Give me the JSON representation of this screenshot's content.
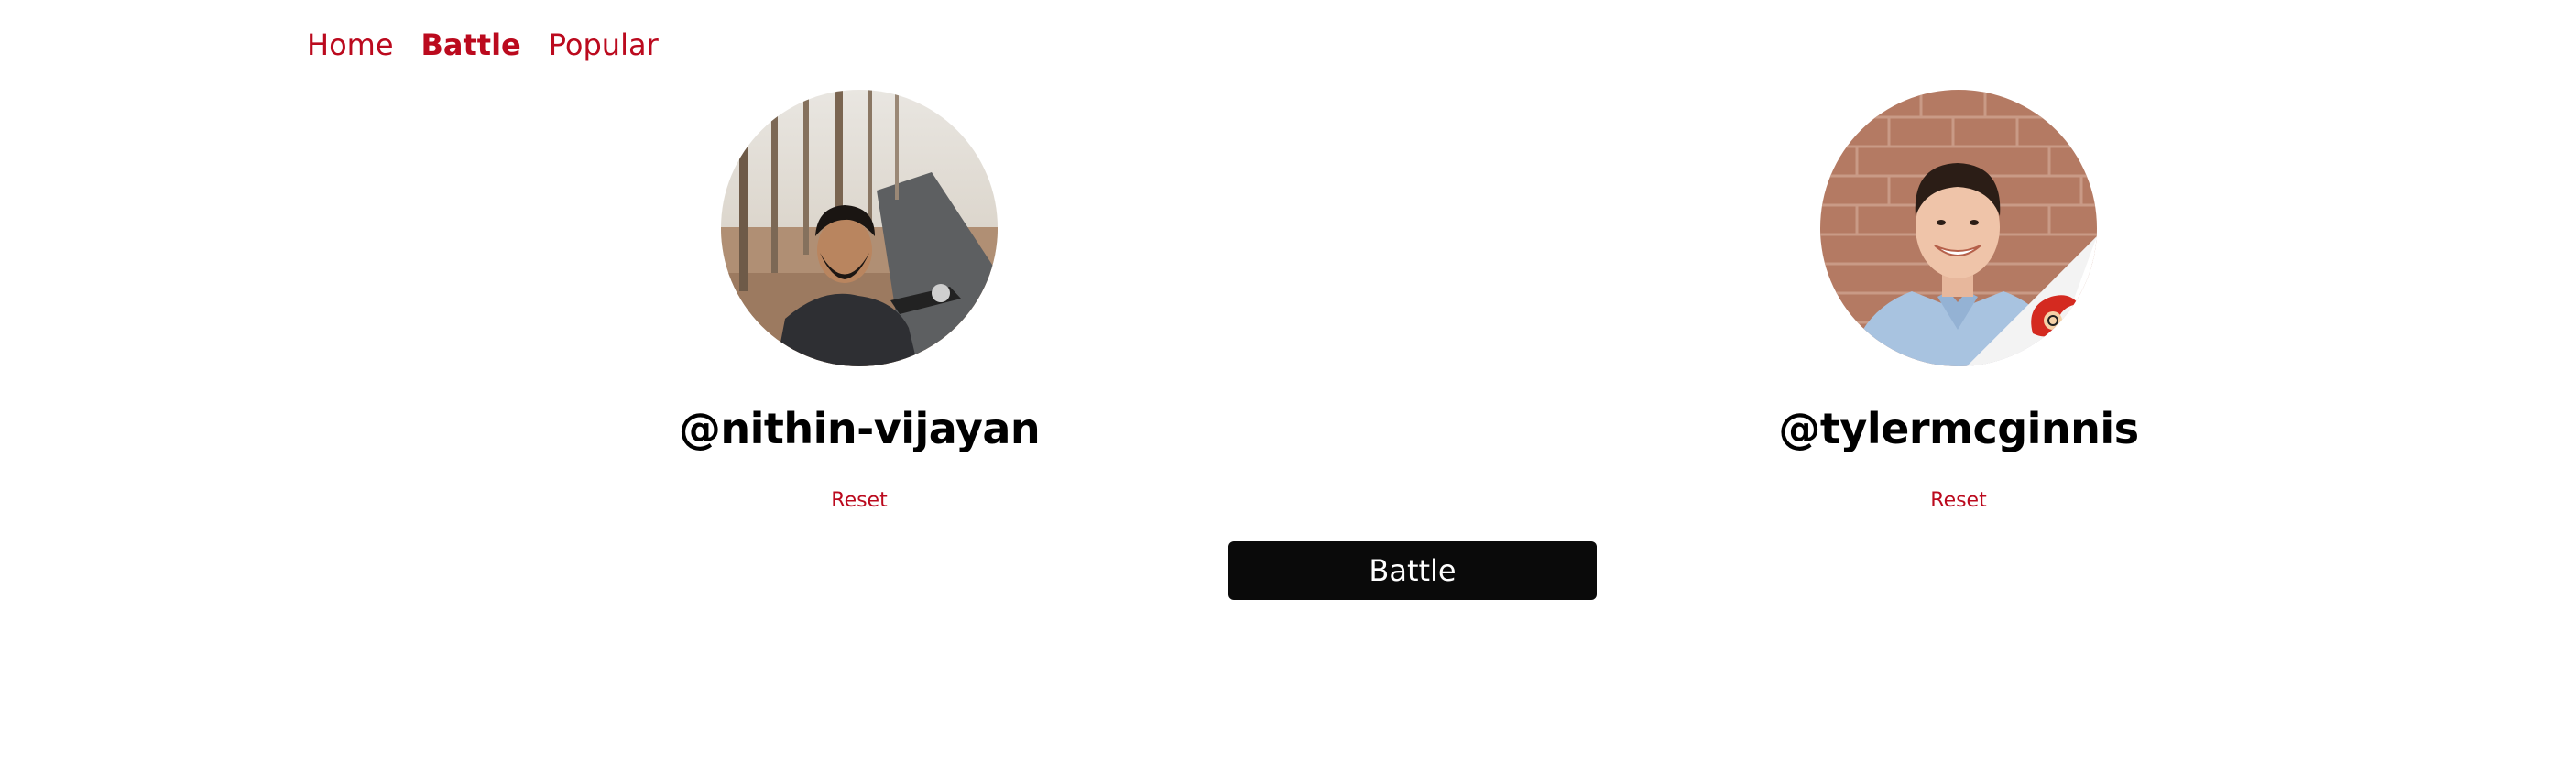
{
  "nav": {
    "items": [
      {
        "label": "Home",
        "active": false
      },
      {
        "label": "Battle",
        "active": true
      },
      {
        "label": "Popular",
        "active": false
      }
    ]
  },
  "players": {
    "one": {
      "username": "@nithin-vijayan",
      "reset_label": "Reset"
    },
    "two": {
      "username": "@tylermcginnis",
      "reset_label": "Reset"
    }
  },
  "battle": {
    "label": "Battle"
  },
  "colors": {
    "accent": "#bb0a1e",
    "button_bg": "#0a0a0a",
    "text": "#000000",
    "background": "#ffffff"
  }
}
